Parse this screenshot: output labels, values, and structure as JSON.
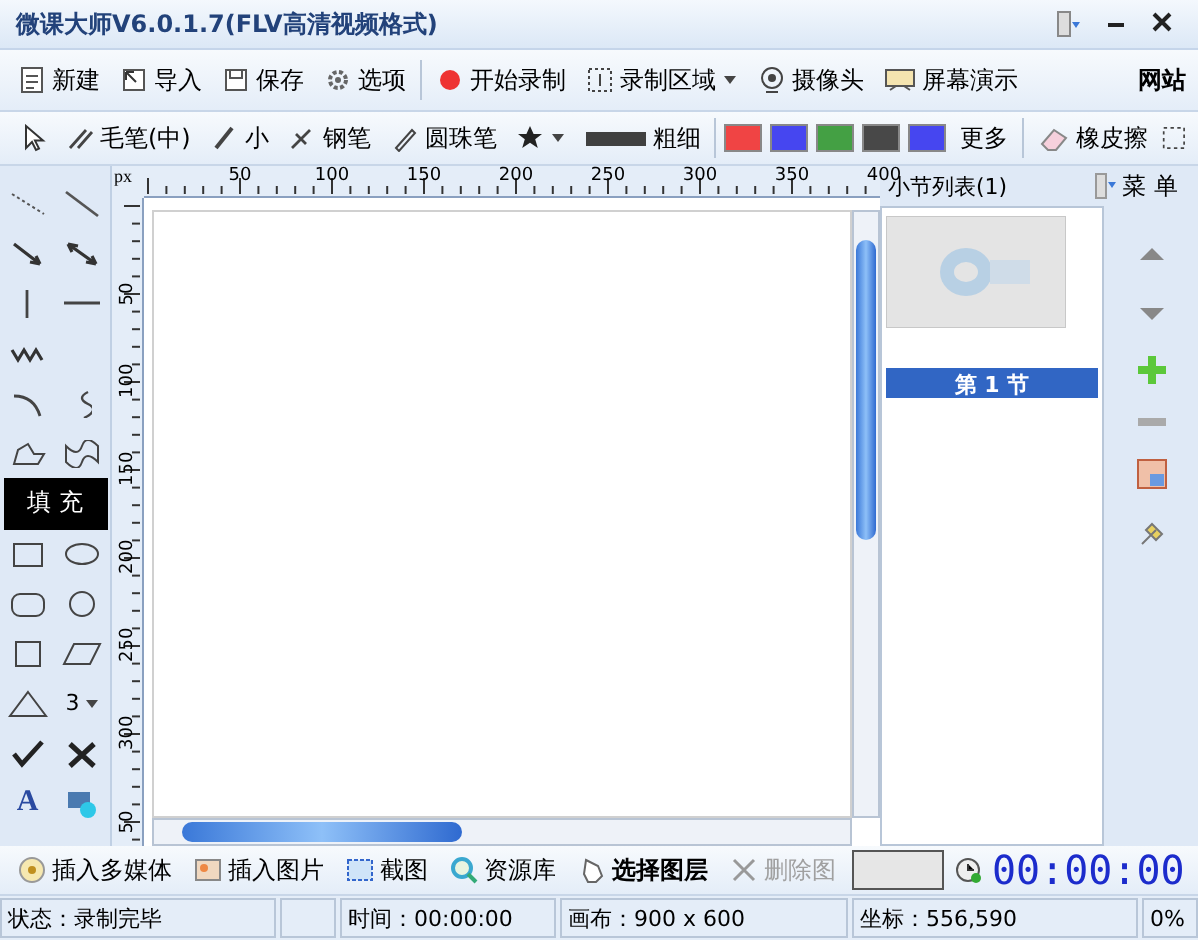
{
  "window": {
    "title": "微课大师V6.0.1.7(FLV高清视频格式)"
  },
  "toolbar": {
    "buttons": [
      {
        "label": "新建"
      },
      {
        "label": "导入"
      },
      {
        "label": "保存"
      },
      {
        "label": "选项"
      },
      {
        "label": "开始录制"
      },
      {
        "label": "录制区域",
        "dropdown": true
      },
      {
        "label": "摄像头"
      },
      {
        "label": "屏幕演示"
      }
    ],
    "link": "网站"
  },
  "pen_toolbar": {
    "pens": [
      {
        "label": "毛笔(中)"
      },
      {
        "label": "小"
      },
      {
        "label": "钢笔"
      },
      {
        "label": "圆珠笔"
      }
    ],
    "weight_label": "粗细",
    "colors": [
      {
        "color": "#f04444"
      },
      {
        "color": "#4646f0"
      },
      {
        "color": "#44a044"
      },
      {
        "color": "#484848"
      },
      {
        "color": "#4646f0"
      }
    ],
    "more": "更多",
    "eraser": "橡皮擦"
  },
  "palette": {
    "fill_button": "填 充",
    "layer_count": "3",
    "text_tool": "A"
  },
  "ruler": {
    "unit": "px",
    "x_labels": [
      "50",
      "100",
      "150",
      "200",
      "250",
      "300",
      "350",
      "400"
    ],
    "y_labels": [
      "50",
      "100",
      "150",
      "200",
      "250",
      "300",
      "50"
    ]
  },
  "sections": {
    "title": "小节列表(1)",
    "menu": "菜 单",
    "items": [
      {
        "label": "第 1 节",
        "selected": true
      }
    ]
  },
  "bottom_toolbar": {
    "buttons": [
      {
        "label": "插入多媒体",
        "disabled": false
      },
      {
        "label": "插入图片",
        "disabled": false
      },
      {
        "label": "截图",
        "disabled": false
      },
      {
        "label": "资源库",
        "disabled": false
      },
      {
        "label": "选择图层",
        "disabled": false
      },
      {
        "label": "删除图",
        "disabled": true
      }
    ],
    "timer": "00:00:00"
  },
  "status_bar": {
    "status": "状态：录制完毕",
    "time": "时间：00:00:00",
    "canvas": "画布：900 x 600",
    "coords": "坐标：556,590",
    "zoom": "0%"
  }
}
